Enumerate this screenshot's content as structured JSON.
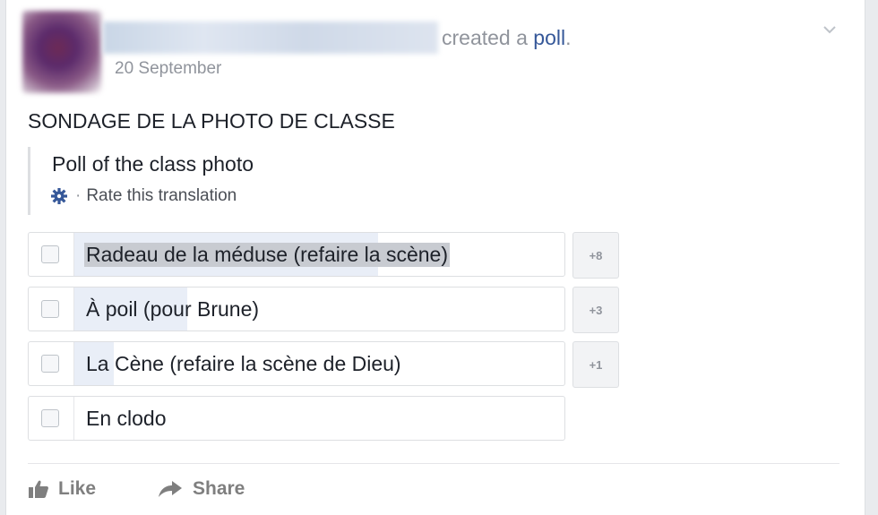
{
  "post": {
    "headline_action": "created a",
    "headline_link": "poll",
    "headline_end": ".",
    "date": "20 September",
    "poll_title": "SONDAGE DE LA PHOTO DE CLASSE",
    "translation": {
      "text": "Poll of the class photo",
      "rate_label": "Rate this translation",
      "separator": "·"
    }
  },
  "options": [
    {
      "label": "Radeau de la méduse (refaire la scène)",
      "count": "+8",
      "vote_fraction": 0.62,
      "selected_text": true
    },
    {
      "label": "À poil (pour Brune)",
      "count": "+3",
      "vote_fraction": 0.23,
      "selected_text": false
    },
    {
      "label": "La Cène (refaire la scène de Dieu)",
      "count": "+1",
      "vote_fraction": 0.08,
      "selected_text": false
    },
    {
      "label": "En clodo",
      "count": "",
      "vote_fraction": 0,
      "selected_text": false
    }
  ],
  "actions": {
    "like": "Like",
    "share": "Share"
  },
  "colors": {
    "link": "#365899",
    "meta": "#90949c",
    "bar_fill": "#e9eef7",
    "border": "#dddfe2"
  },
  "icons": {
    "options_menu": "chevron-down-icon",
    "translation": "gear-icon",
    "like": "thumbs-up-icon",
    "share": "share-arrow-icon"
  }
}
